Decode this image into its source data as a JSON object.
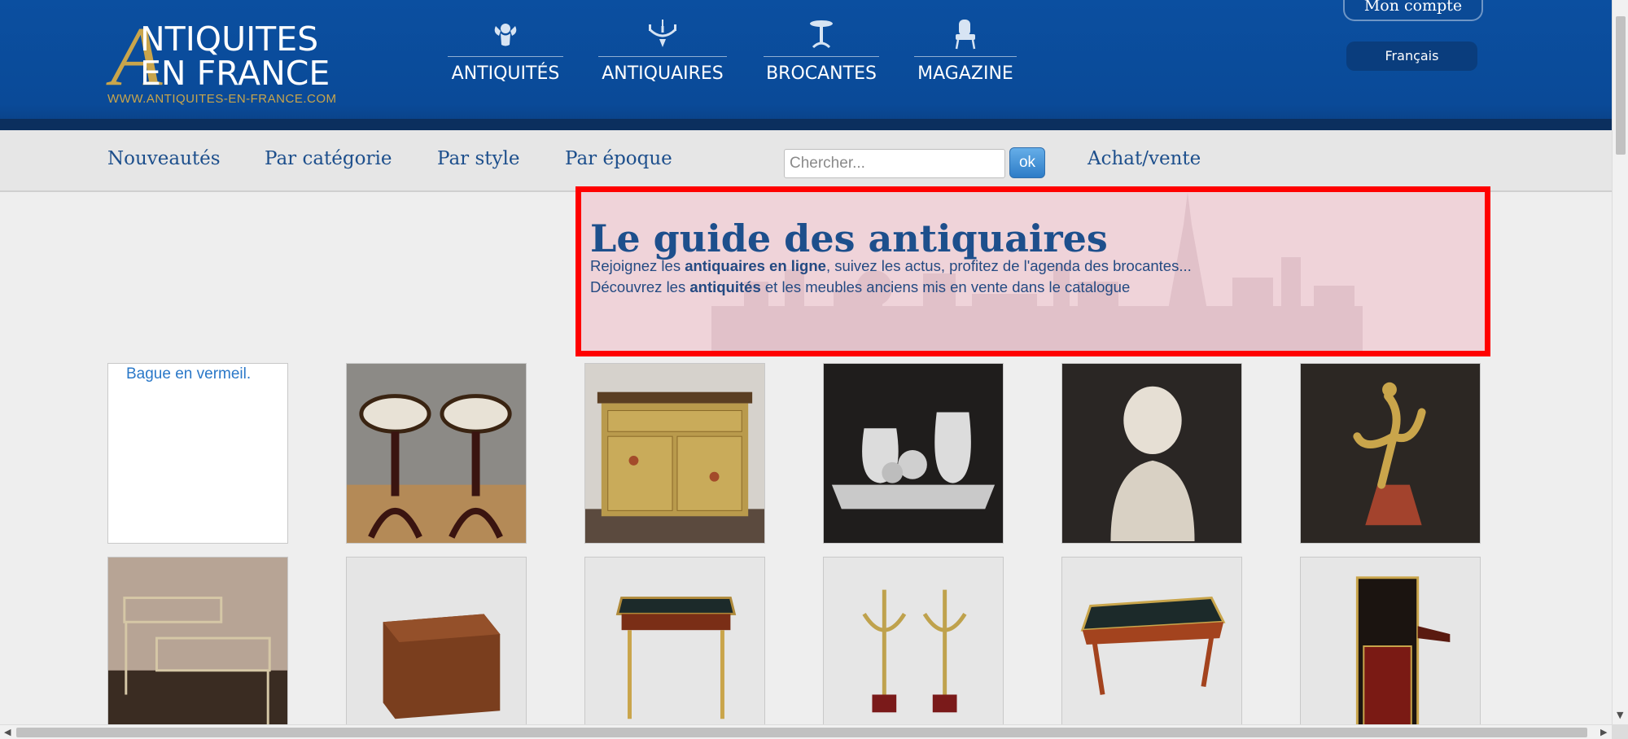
{
  "logo": {
    "big_letter": "A",
    "line1": "NTIQUITES",
    "line2": "EN FRANCE",
    "url": "WWW.ANTIQUITES-EN-FRANCE.COM"
  },
  "top_nav": [
    {
      "label": "ANTIQUITÉS",
      "icon": "cherub-icon"
    },
    {
      "label": "ANTIQUAIRES",
      "icon": "chandelier-icon"
    },
    {
      "label": "BROCANTES",
      "icon": "gueridon-table-icon"
    },
    {
      "label": "MAGAZINE",
      "icon": "armchair-icon"
    }
  ],
  "account": {
    "label": "Mon compte"
  },
  "language": {
    "label": "Français"
  },
  "sub_nav": {
    "items": [
      "Nouveautés",
      "Par catégorie",
      "Par style",
      "Par époque"
    ],
    "search_placeholder": "Chercher...",
    "search_button": "ok",
    "buy_sell": "Achat/vente"
  },
  "hero": {
    "title": "Le guide des antiquaires",
    "line1_pre": "Rejoignez les ",
    "line1_bold": "antiquaires en ligne",
    "line1_post": ", suivez les actus, profitez de l'agenda des brocantes...",
    "line2_pre": "Découvrez les ",
    "line2_bold": "antiquités",
    "line2_post": " et les meubles anciens mis en vente dans le catalogue"
  },
  "products": {
    "row1": [
      {
        "alt": "Bague en vermeil.",
        "broken": true
      },
      {
        "icon": "pair-of-gueridons-image"
      },
      {
        "icon": "painted-commode-image"
      },
      {
        "icon": "silver-tea-set-image"
      },
      {
        "icon": "marble-bust-image"
      },
      {
        "icon": "gilt-bronze-dancer-image"
      }
    ],
    "row2": [
      {
        "icon": "glass-nesting-tables-image"
      },
      {
        "icon": "wooden-box-image"
      },
      {
        "icon": "writing-desk-image"
      },
      {
        "icon": "candelabra-pair-image"
      },
      {
        "icon": "bureau-plat-image"
      },
      {
        "icon": "secretaire-image"
      }
    ]
  },
  "colors": {
    "header_blue": "#0b4fa0",
    "gold": "#c9a54b",
    "link_blue": "#1d4f8c",
    "highlight_red": "#ff0000"
  }
}
